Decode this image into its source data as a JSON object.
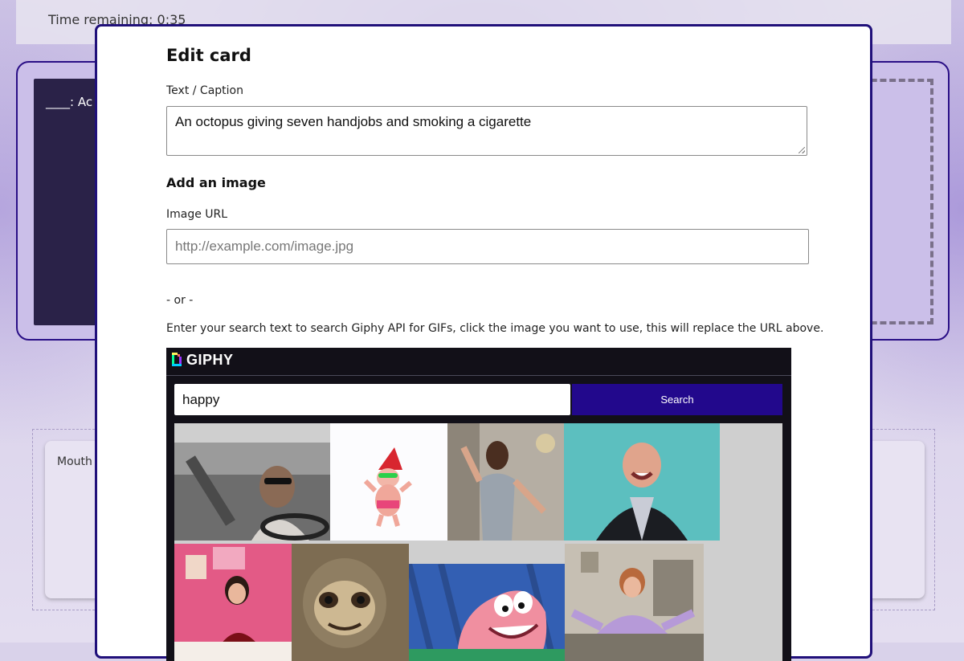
{
  "background": {
    "timer_text": "Time remaining: 0:35",
    "black_card_text": "____: Ac",
    "hand_card_text": "Mouth"
  },
  "modal": {
    "title": "Edit card",
    "caption_label": "Text / Caption",
    "caption_value": "An octopus giving seven handjobs and smoking a cigarette",
    "image_section_title": "Add an image",
    "image_url_label": "Image URL",
    "image_url_placeholder": "http://example.com/image.jpg",
    "or_text": "- or -",
    "help_text": "Enter your search text to search Giphy API for GIFs, click the image you want to use, this will replace the URL above."
  },
  "giphy": {
    "logo_text": "GIPHY",
    "search_value": "happy",
    "search_button_label": "Search",
    "results": [
      {
        "name": "gif-result-man-in-car"
      },
      {
        "name": "gif-result-dancing-baby-gnome"
      },
      {
        "name": "gif-result-woman-dancing"
      },
      {
        "name": "gif-result-man-laughing"
      },
      {
        "name": "gif-result-woman-at-desk"
      },
      {
        "name": "gif-result-sloth"
      },
      {
        "name": "gif-result-patrick-star"
      },
      {
        "name": "gif-result-woman-cheering"
      }
    ]
  },
  "colors": {
    "modal_border": "#20107a",
    "search_button": "#22088c",
    "giphy_bg": "#121018"
  }
}
